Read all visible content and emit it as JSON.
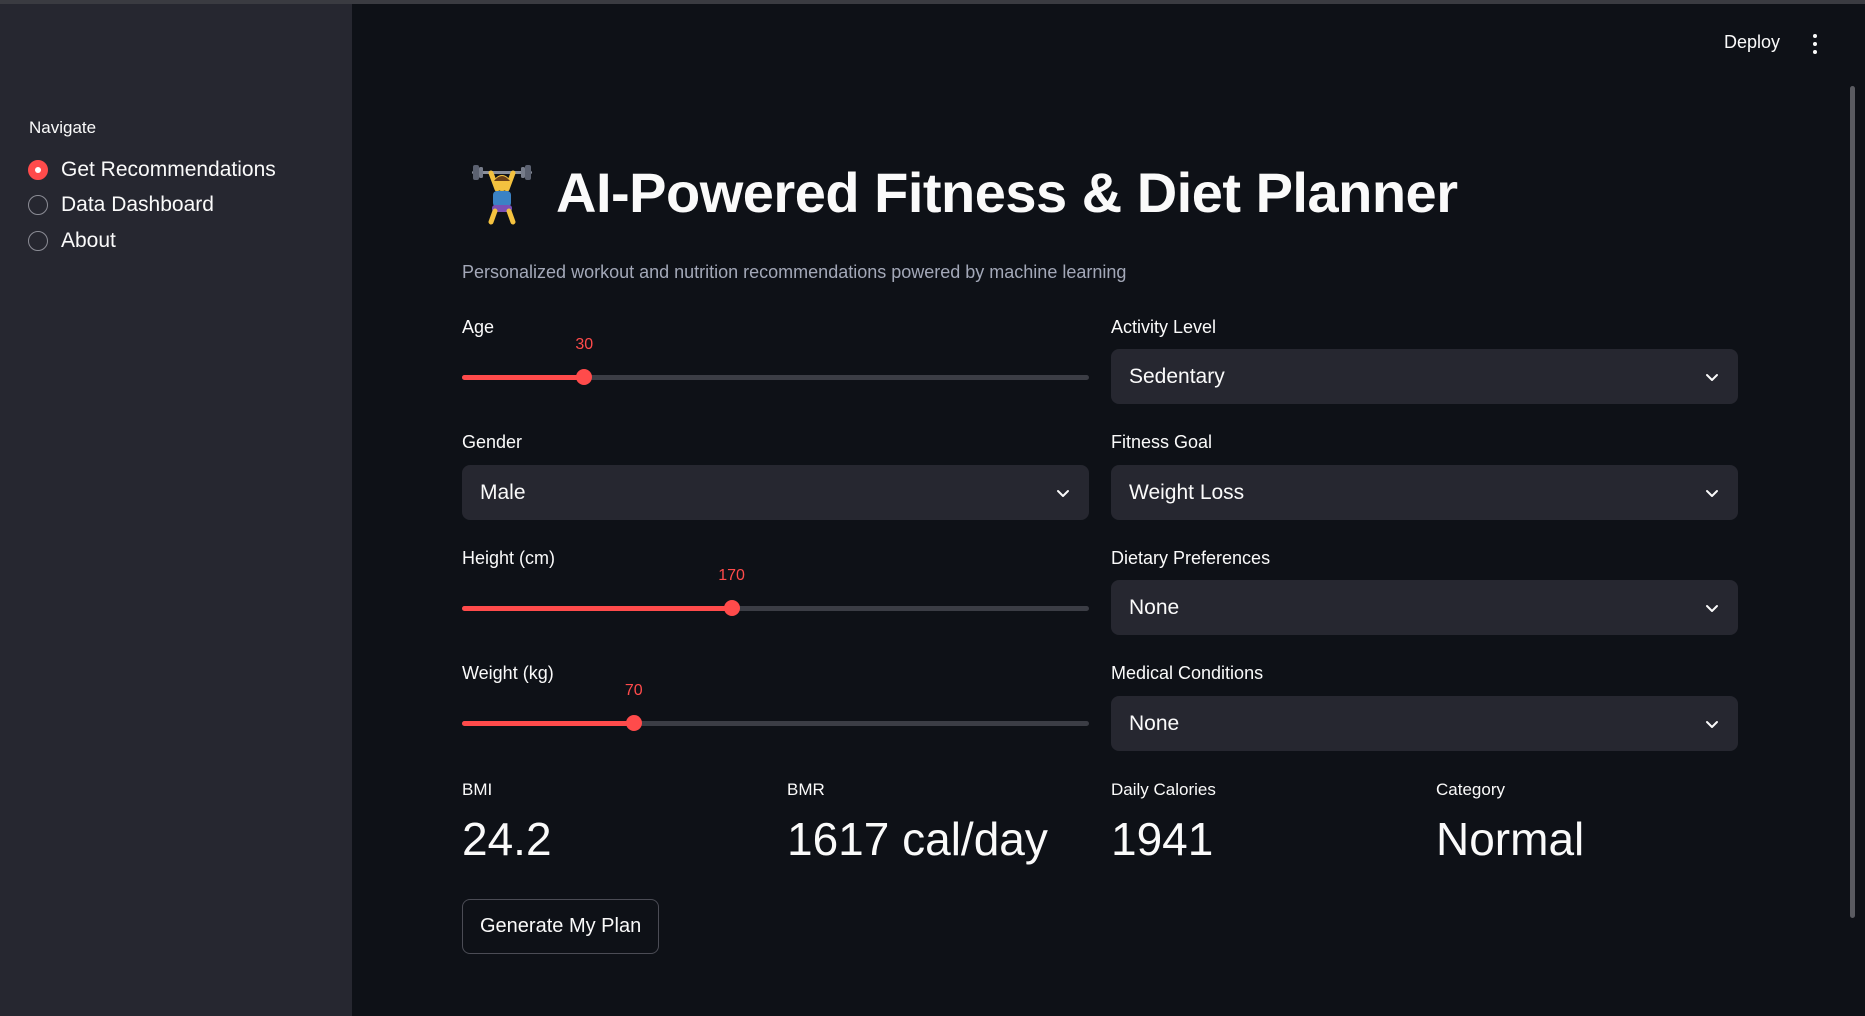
{
  "sidebar": {
    "nav_label": "Navigate",
    "items": [
      {
        "label": "Get Recommendations",
        "selected": true
      },
      {
        "label": "Data Dashboard",
        "selected": false
      },
      {
        "label": "About",
        "selected": false
      }
    ]
  },
  "header": {
    "deploy_label": "Deploy",
    "menu_icon": "kebab-menu-icon"
  },
  "main": {
    "title_icon": "weightlifter-emoji",
    "title": "AI-Powered Fitness & Diet Planner",
    "subtitle": "Personalized workout and nutrition recommendations powered by machine learning",
    "age": {
      "label": "Age",
      "value": "30",
      "fraction": 0.195
    },
    "gender": {
      "label": "Gender",
      "value": "Male"
    },
    "height": {
      "label": "Height (cm)",
      "value": "170",
      "fraction": 0.43
    },
    "weight": {
      "label": "Weight (kg)",
      "value": "70",
      "fraction": 0.274
    },
    "activity": {
      "label": "Activity Level",
      "value": "Sedentary"
    },
    "goal": {
      "label": "Fitness Goal",
      "value": "Weight Loss"
    },
    "diet": {
      "label": "Dietary Preferences",
      "value": "None"
    },
    "medical": {
      "label": "Medical Conditions",
      "value": "None"
    },
    "metrics": [
      {
        "label": "BMI",
        "value": "24.2"
      },
      {
        "label": "BMR",
        "value": "1617 cal/day"
      },
      {
        "label": "Daily Calories",
        "value": "1941"
      },
      {
        "label": "Category",
        "value": "Normal"
      }
    ],
    "generate_label": "Generate My Plan"
  },
  "colors": {
    "accent": "#ff4b4b",
    "background": "#0e1117",
    "sidebar": "#262730",
    "input": "#262730"
  }
}
